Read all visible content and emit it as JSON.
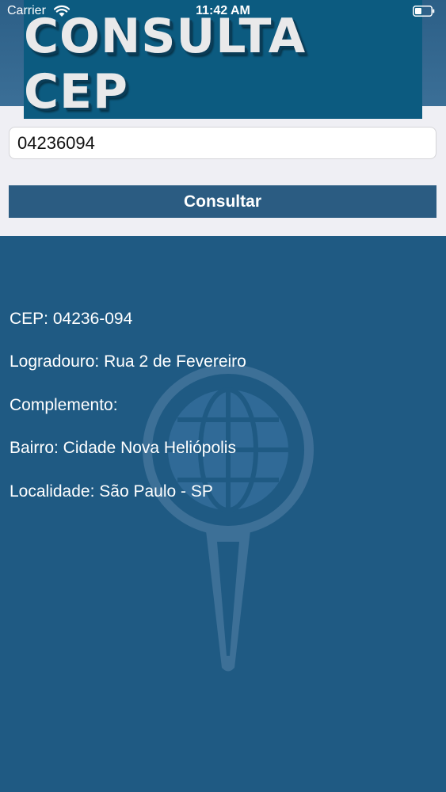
{
  "status_bar": {
    "carrier": "Carrier",
    "time": "11:42 AM"
  },
  "banner": {
    "title": "CONSULTA CEP"
  },
  "form": {
    "cep_value": "04236094",
    "button_label": "Consultar"
  },
  "results": {
    "cep": "CEP: 04236-094",
    "logradouro": "Logradouro: Rua 2 de Fevereiro",
    "complemento": "Complemento:",
    "bairro": "Bairro: Cidade Nova Heliópolis",
    "localidade": "Localidade: São Paulo - SP"
  },
  "colors": {
    "header_blue": "#0c5b80",
    "background_blue": "#1f5a83",
    "button_blue": "#2b5c82",
    "panel_gray": "#efeff4"
  },
  "icons": [
    "wifi-icon",
    "battery-icon",
    "globe-pin-icon"
  ]
}
